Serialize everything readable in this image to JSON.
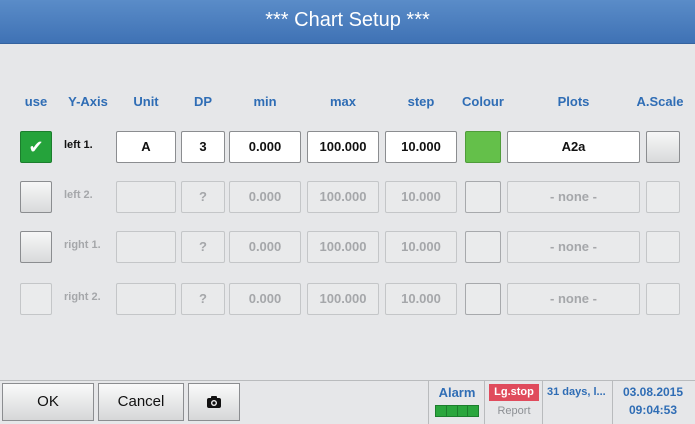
{
  "title": "***  Chart Setup  ***",
  "headers": {
    "use": "use",
    "yaxis": "Y-Axis",
    "unit": "Unit",
    "dp": "DP",
    "min": "min",
    "max": "max",
    "step": "step",
    "colour": "Colour",
    "plots": "Plots",
    "ascale": "A.Scale"
  },
  "rows": [
    {
      "checked": true,
      "label": "left 1.",
      "unit": "A",
      "dp": "3",
      "min": "0.000",
      "max": "100.000",
      "step": "10.000",
      "colour": "#64c04a",
      "plot": "A2a",
      "enabled": true
    },
    {
      "checked": false,
      "label": "left 2.",
      "unit": "",
      "dp": "?",
      "min": "0.000",
      "max": "100.000",
      "step": "10.000",
      "colour": "",
      "plot": "- none -",
      "enabled": false
    },
    {
      "checked": false,
      "label": "right 1.",
      "unit": "",
      "dp": "?",
      "min": "0.000",
      "max": "100.000",
      "step": "10.000",
      "colour": "",
      "plot": "- none -",
      "enabled": false
    },
    {
      "checked": false,
      "label": "right 2.",
      "unit": "",
      "dp": "?",
      "min": "0.000",
      "max": "100.000",
      "step": "10.000",
      "colour": "",
      "plot": "- none -",
      "enabled": false
    }
  ],
  "footer": {
    "ok": "OK",
    "cancel": "Cancel",
    "camera_icon": "camera-icon",
    "alarm": "Alarm",
    "lgstop": "Lg.stop",
    "report": "Report",
    "duration": "31 days, l...",
    "date": "03.08.2015",
    "time": "09:04:53"
  }
}
